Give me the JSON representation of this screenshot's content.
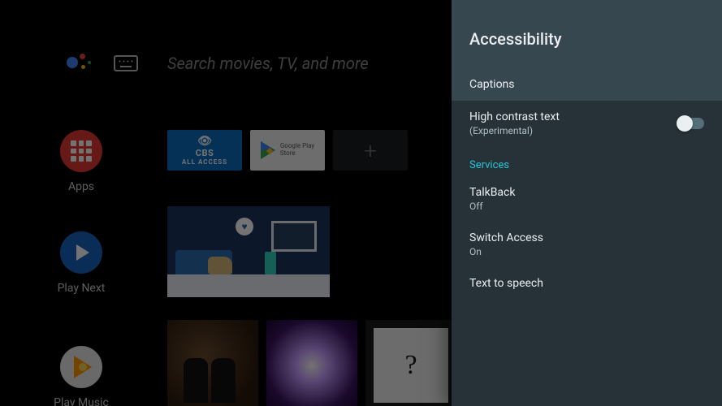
{
  "search": {
    "placeholder": "Search movies, TV, and more"
  },
  "rail": {
    "apps": "Apps",
    "play_next": "Play Next",
    "play_music": "Play Music"
  },
  "tiles": {
    "cbs_line1": "CBS",
    "cbs_line2": "ALL ACCESS",
    "play_line1": "Google Play",
    "play_line2": "Store"
  },
  "panel": {
    "title": "Accessibility",
    "captions": "Captions",
    "high_contrast": "High contrast text",
    "high_contrast_sub": "(Experimental)",
    "services_header": "Services",
    "talkback": "TalkBack",
    "talkback_status": "Off",
    "switch_access": "Switch Access",
    "switch_access_status": "On",
    "tts": "Text to speech"
  }
}
